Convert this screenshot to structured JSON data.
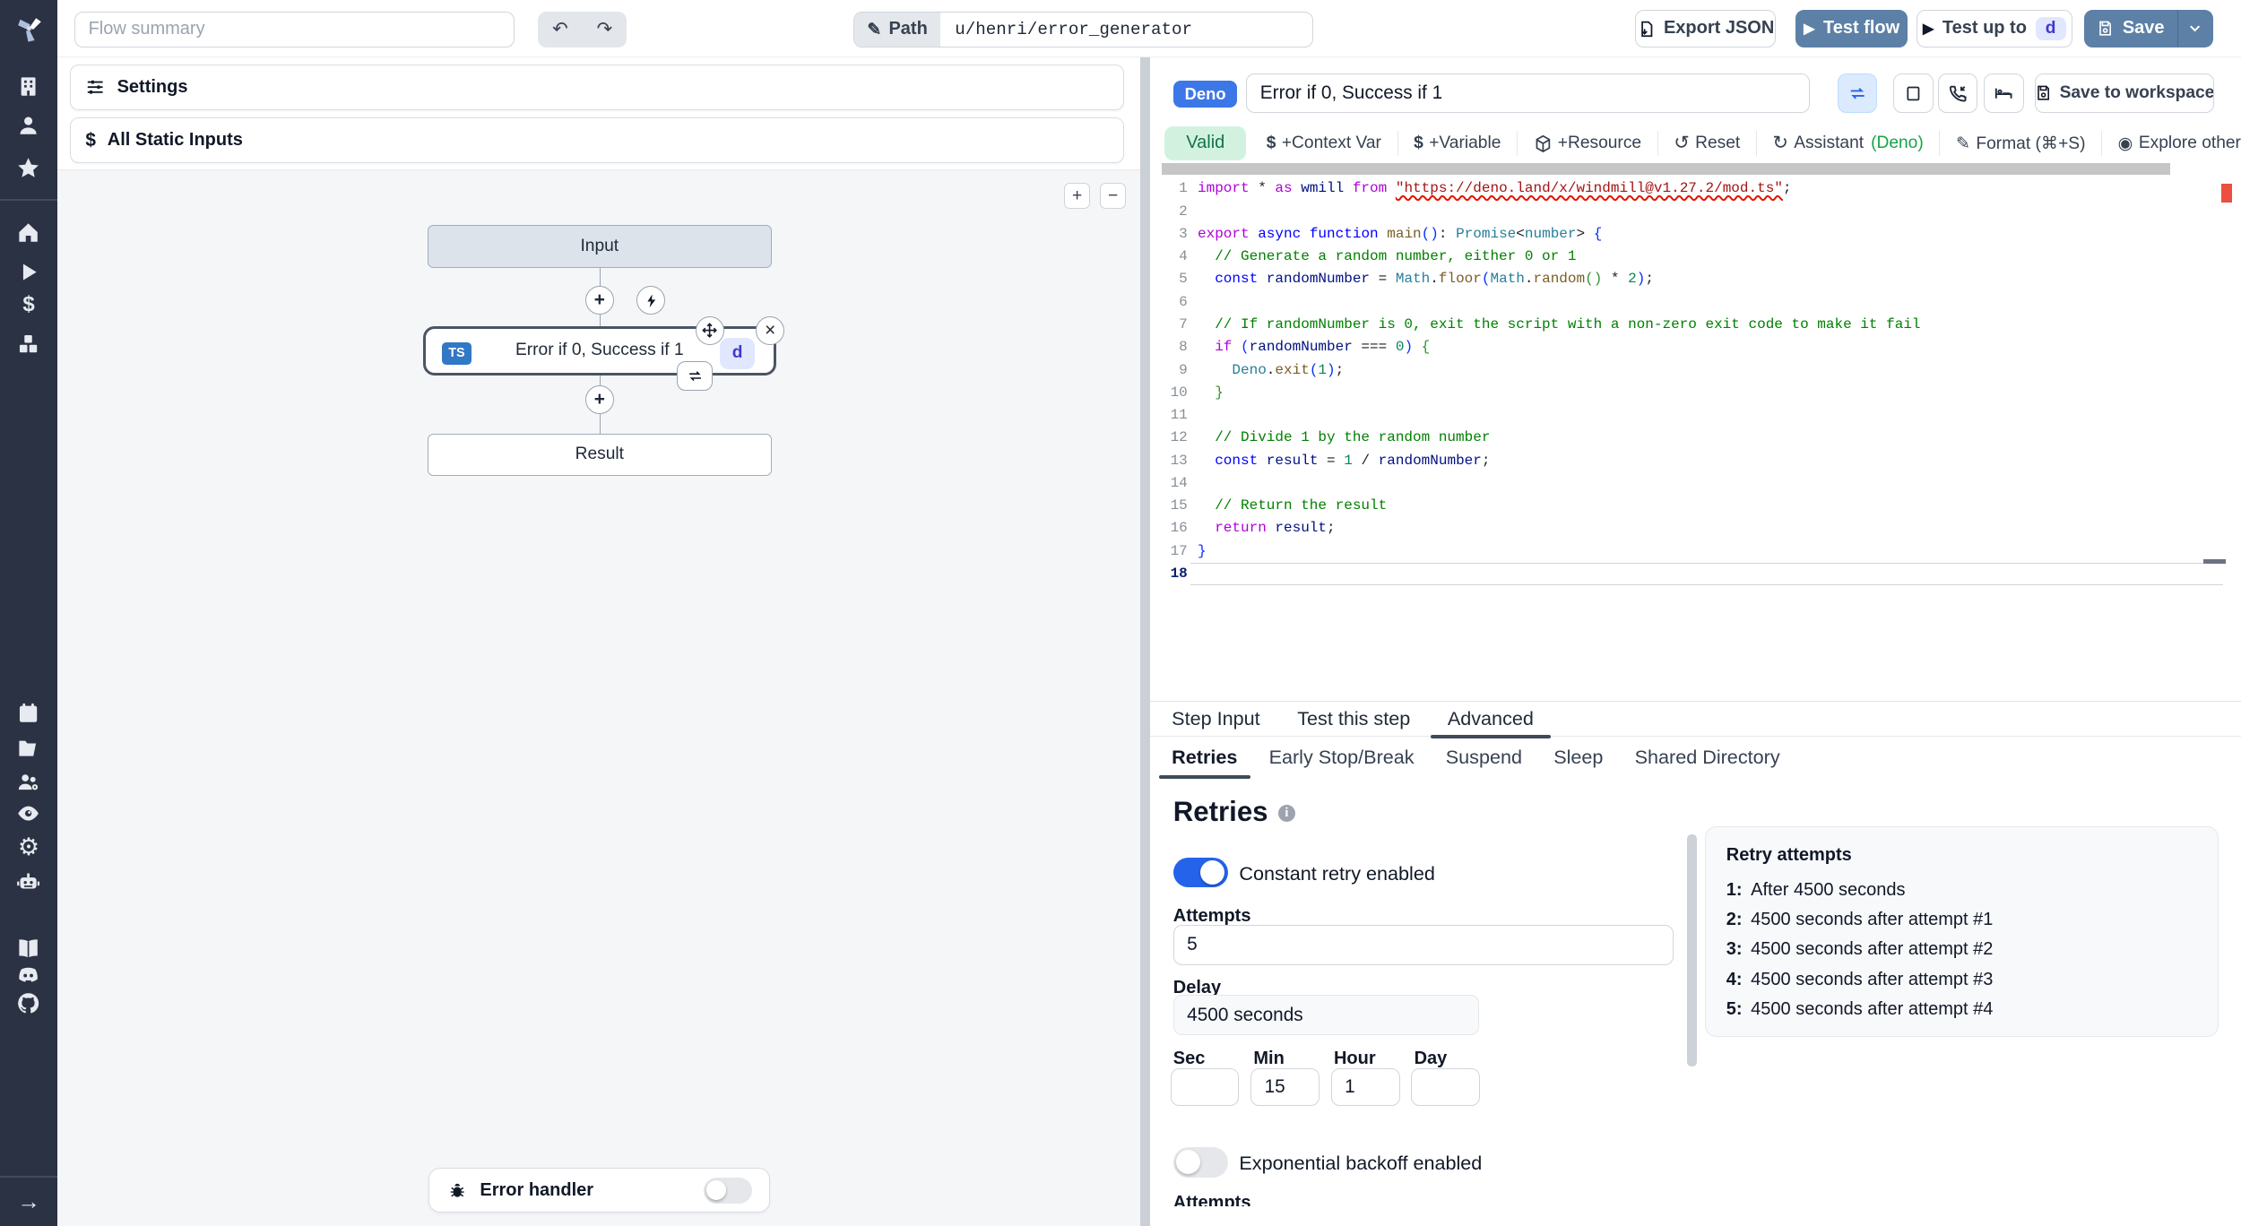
{
  "colors": {
    "primary": "#5d80a6",
    "sidebar_bg": "#2b3243",
    "toggle_on": "#2563eb",
    "deno_badge": "#3c77e8",
    "ts_badge": "#3178c6",
    "valid_bg": "#d2f2df",
    "valid_text": "#14734b"
  },
  "sidebar": {
    "items": [
      "building",
      "user",
      "star",
      "home",
      "play",
      "dollar",
      "cubes",
      "calendar",
      "folder",
      "users-cog",
      "eye",
      "gear",
      "robot",
      "book",
      "discord",
      "github",
      "arrow-right"
    ]
  },
  "topbar": {
    "flow_summary_placeholder": "Flow summary",
    "path_label": "Path",
    "path_value": "u/henri/error_generator",
    "export_json": "Export JSON",
    "test_flow": "Test flow",
    "test_up_to": "Test up to",
    "test_up_to_badge": "d",
    "save": "Save"
  },
  "left_panel": {
    "settings": "Settings",
    "static_inputs": "All Static Inputs",
    "zoom_in": "+",
    "zoom_out": "−",
    "graph": {
      "input_node": "Input",
      "step_node": "Error if 0, Success if 1",
      "step_lang_badge": "TS",
      "step_id_badge": "d",
      "result_node": "Result",
      "error_handler": "Error handler"
    }
  },
  "right_panel": {
    "lang_badge": "Deno",
    "step_name": "Error if 0, Success if 1",
    "save_to_workspace": "Save to workspace",
    "toolbar": {
      "valid": "Valid",
      "items": [
        {
          "icon": "dollar",
          "label": "+Context Var"
        },
        {
          "icon": "dollar",
          "label": "+Variable"
        },
        {
          "icon": "cube",
          "label": "+Resource"
        },
        {
          "icon": "reset",
          "label": "Reset"
        },
        {
          "icon": "assistant",
          "label": "Assistant",
          "suffix": "(Deno)",
          "suffix_color": "#16a34a"
        },
        {
          "icon": "format",
          "label": "Format (⌘+S)"
        },
        {
          "icon": "explore",
          "label": "Explore other s"
        }
      ]
    },
    "tabs": [
      {
        "label": "Step Input",
        "active": false
      },
      {
        "label": "Test this step",
        "active": false
      },
      {
        "label": "Advanced",
        "active": true
      }
    ],
    "subtabs": [
      {
        "label": "Retries",
        "active": true
      },
      {
        "label": "Early Stop/Break",
        "active": false
      },
      {
        "label": "Suspend",
        "active": false
      },
      {
        "label": "Sleep",
        "active": false
      },
      {
        "label": "Shared Directory",
        "active": false
      }
    ],
    "retries": {
      "heading": "Retries",
      "constant_toggle": "Constant retry enabled",
      "attempts_label": "Attempts",
      "attempts_value": "5",
      "delay_label": "Delay",
      "delay_value": "4500 seconds",
      "time_fields": [
        {
          "label": "Sec",
          "value": ""
        },
        {
          "label": "Min",
          "value": "15"
        },
        {
          "label": "Hour",
          "value": "1"
        },
        {
          "label": "Day",
          "value": ""
        }
      ],
      "exponential_toggle": "Exponential backoff enabled",
      "next_section_label": "Attempts"
    },
    "retry_attempts": {
      "title": "Retry attempts",
      "items": [
        {
          "n": "1:",
          "text": "After 4500 seconds"
        },
        {
          "n": "2:",
          "text": "4500 seconds after attempt #1"
        },
        {
          "n": "3:",
          "text": "4500 seconds after attempt #2"
        },
        {
          "n": "4:",
          "text": "4500 seconds after attempt #3"
        },
        {
          "n": "5:",
          "text": "4500 seconds after attempt #4"
        }
      ]
    },
    "code": {
      "active_line": 18,
      "lines": [
        [
          [
            "kw2",
            "import"
          ],
          [
            "pl",
            " * "
          ],
          [
            "kw2",
            "as"
          ],
          [
            "vr",
            " wmill "
          ],
          [
            "kw2",
            "from"
          ],
          [
            "pl",
            " "
          ],
          [
            "str",
            "\"https://deno.land/x/windmill@v1.27.2/mod.ts\""
          ],
          [
            "pl",
            ";"
          ]
        ],
        [],
        [
          [
            "kw2",
            "export"
          ],
          [
            "pl",
            " "
          ],
          [
            "kw",
            "async"
          ],
          [
            "pl",
            " "
          ],
          [
            "kw",
            "function"
          ],
          [
            "fn",
            " main"
          ],
          [
            "br",
            "()"
          ],
          [
            "pl",
            ": "
          ],
          [
            "ty",
            "Promise"
          ],
          [
            "pl",
            "<"
          ],
          [
            "ty",
            "number"
          ],
          [
            "pl",
            "> "
          ],
          [
            "br",
            "{"
          ]
        ],
        [
          [
            "cm",
            "  // Generate a random number, either 0 or 1"
          ]
        ],
        [
          [
            "pl",
            "  "
          ],
          [
            "kw",
            "const"
          ],
          [
            "vr",
            " randomNumber"
          ],
          [
            "pl",
            " = "
          ],
          [
            "ty",
            "Math"
          ],
          [
            "pl",
            "."
          ],
          [
            "fn",
            "floor"
          ],
          [
            "br",
            "("
          ],
          [
            "ty",
            "Math"
          ],
          [
            "pl",
            "."
          ],
          [
            "fn",
            "random"
          ],
          [
            "br2",
            "()"
          ],
          [
            "pl",
            " * "
          ],
          [
            "num",
            "2"
          ],
          [
            "br",
            ")"
          ],
          [
            "pl",
            ";"
          ]
        ],
        [],
        [
          [
            "cm",
            "  // If randomNumber is 0, exit the script with a non-zero exit code to make it fail"
          ]
        ],
        [
          [
            "pl",
            "  "
          ],
          [
            "kw2",
            "if"
          ],
          [
            "pl",
            " "
          ],
          [
            "br",
            "("
          ],
          [
            "vr",
            "randomNumber"
          ],
          [
            "pl",
            " === "
          ],
          [
            "num",
            "0"
          ],
          [
            "br",
            ")"
          ],
          [
            "pl",
            " "
          ],
          [
            "br2",
            "{"
          ]
        ],
        [
          [
            "pl",
            "    "
          ],
          [
            "ty",
            "Deno"
          ],
          [
            "pl",
            "."
          ],
          [
            "fn",
            "exit"
          ],
          [
            "br",
            "("
          ],
          [
            "num",
            "1"
          ],
          [
            "br",
            ")"
          ],
          [
            "pl",
            ";"
          ]
        ],
        [
          [
            "br2",
            "  }"
          ]
        ],
        [],
        [
          [
            "cm",
            "  // Divide 1 by the random number"
          ]
        ],
        [
          [
            "pl",
            "  "
          ],
          [
            "kw",
            "const"
          ],
          [
            "vr",
            " result"
          ],
          [
            "pl",
            " = "
          ],
          [
            "num",
            "1"
          ],
          [
            "pl",
            " / "
          ],
          [
            "vr",
            "randomNumber"
          ],
          [
            "pl",
            ";"
          ]
        ],
        [],
        [
          [
            "cm",
            "  // Return the result"
          ]
        ],
        [
          [
            "pl",
            "  "
          ],
          [
            "kw2",
            "return"
          ],
          [
            "vr",
            " result"
          ],
          [
            "pl",
            ";"
          ]
        ],
        [
          [
            "br",
            "}"
          ]
        ],
        []
      ]
    }
  }
}
